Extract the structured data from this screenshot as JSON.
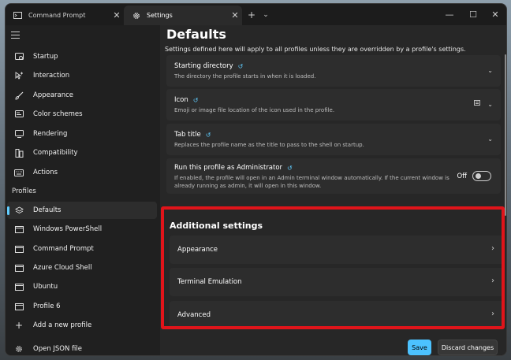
{
  "tabs": [
    {
      "label": "Command Prompt",
      "icon": "cmd-icon",
      "close": "✕"
    },
    {
      "label": "Settings",
      "icon": "gear-icon",
      "close": "✕"
    }
  ],
  "tabbar": {
    "new_tab": "+",
    "dropdown": "⌄"
  },
  "window_controls": {
    "minimize": "—",
    "maximize": "☐",
    "close": "✕"
  },
  "sidebar": {
    "items": [
      {
        "label": "Startup",
        "icon": "startup-icon"
      },
      {
        "label": "Interaction",
        "icon": "interaction-icon"
      },
      {
        "label": "Appearance",
        "icon": "brush-icon"
      },
      {
        "label": "Color schemes",
        "icon": "palette-icon"
      },
      {
        "label": "Rendering",
        "icon": "monitor-icon"
      },
      {
        "label": "Compatibility",
        "icon": "compatibility-icon"
      },
      {
        "label": "Actions",
        "icon": "keyboard-icon"
      }
    ],
    "profiles_heading": "Profiles",
    "profiles": [
      {
        "label": "Defaults",
        "icon": "layers-icon",
        "selected": true
      },
      {
        "label": "Windows PowerShell",
        "icon": "terminal-icon"
      },
      {
        "label": "Command Prompt",
        "icon": "terminal-icon"
      },
      {
        "label": "Azure Cloud Shell",
        "icon": "terminal-icon"
      },
      {
        "label": "Ubuntu",
        "icon": "terminal-icon"
      },
      {
        "label": "Profile 6",
        "icon": "terminal-icon"
      }
    ],
    "add_profile": "Add a new profile",
    "open_json": "Open JSON file"
  },
  "main": {
    "title": "Defaults",
    "description": "Settings defined here will apply to all profiles unless they are overridden by a profile's settings.",
    "settings": [
      {
        "title": "Starting directory",
        "desc": "The directory the profile starts in when it is loaded."
      },
      {
        "title": "Icon",
        "desc": "Emoji or image file location of the icon used in the profile."
      },
      {
        "title": "Tab title",
        "desc": "Replaces the profile name as the title to pass to the shell on startup."
      },
      {
        "title": "Run this profile as Administrator",
        "desc_line1": "If enabled, the profile will open in an Admin terminal window automatically. If the current window is",
        "desc_line2": "already running as admin, it will open in this window.",
        "toggle_label": "Off"
      }
    ],
    "additional_heading": "Additional settings",
    "additional": [
      {
        "label": "Appearance"
      },
      {
        "label": "Terminal Emulation"
      },
      {
        "label": "Advanced"
      }
    ],
    "save_label": "Save",
    "discard_label": "Discard changes"
  },
  "colors": {
    "accent": "#4cc2ff",
    "highlight": "#e0141a",
    "background": "#202020"
  }
}
